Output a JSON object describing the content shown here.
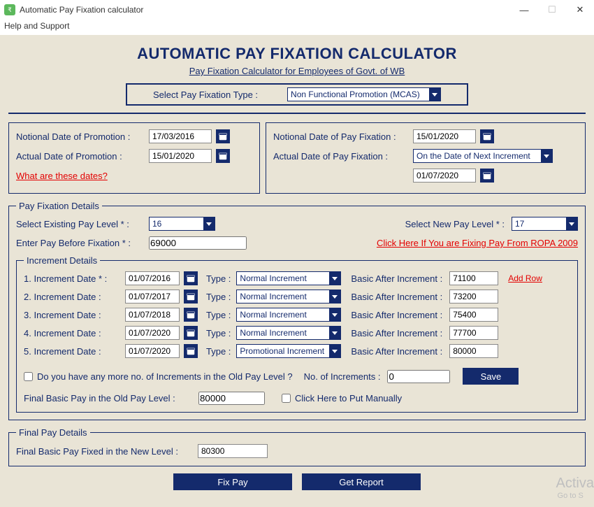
{
  "window": {
    "title": "Automatic Pay Fixation calculator",
    "menu_help": "Help and Support"
  },
  "header": {
    "title": "AUTOMATIC PAY FIXATION CALCULATOR",
    "subtitle": "Pay Fixation Calculator for Employees of Govt. of WB",
    "select_type_label": "Select Pay Fixation Type :",
    "select_type_value": "Non Functional Promotion (MCAS)"
  },
  "left": {
    "notional_label": "Notional Date of Promotion :",
    "notional_date": "17/03/2016",
    "actual_label": "Actual Date of Promotion :",
    "actual_date": "15/01/2020",
    "what_link": "What are these dates?"
  },
  "right": {
    "notional_fix_label": "Notional Date of Pay Fixation :",
    "notional_fix_date": "15/01/2020",
    "actual_fix_label": "Actual Date of Pay Fixation :",
    "actual_fix_value": "On the Date of Next Increment",
    "next_inc_date": "01/07/2020"
  },
  "pf": {
    "legend": "Pay Fixation Details",
    "existing_label": "Select Existing Pay Level * :",
    "existing_value": "16",
    "new_label": "Select New Pay Level * :",
    "new_value": "17",
    "before_label": "Enter Pay Before Fixation * :",
    "before_value": "69000",
    "ropa_link": "Click Here If You are Fixing Pay From ROPA 2009"
  },
  "inc": {
    "legend": "Increment Details",
    "type_label": "Type :",
    "bai_label": "Basic After Increment :",
    "add_row": "Add Row",
    "rows": [
      {
        "idx": "1. Increment Date * :",
        "date": "01/07/2016",
        "type": "Normal Increment",
        "bai": "71100"
      },
      {
        "idx": "2. Increment Date :",
        "date": "01/07/2017",
        "type": "Normal Increment",
        "bai": "73200"
      },
      {
        "idx": "3. Increment Date :",
        "date": "01/07/2018",
        "type": "Normal Increment",
        "bai": "75400"
      },
      {
        "idx": "4. Increment Date :",
        "date": "01/07/2020",
        "type": "Normal Increment",
        "bai": "77700"
      },
      {
        "idx": "5. Increment Date :",
        "date": "01/07/2020",
        "type": "Promotional Increment",
        "bai": "80000"
      }
    ],
    "more_q": "Do you have any more no. of Increments in the Old Pay Level ?",
    "num_label": "No. of Increments :",
    "num_value": "0",
    "save": "Save",
    "final_old_label": "Final Basic Pay in the Old Pay Level :",
    "final_old_value": "80000",
    "manual": "Click Here to Put Manually"
  },
  "final": {
    "legend": "Final Pay Details",
    "label": "Final Basic Pay Fixed in the New Level :",
    "value": "80300"
  },
  "buttons": {
    "fix": "Fix Pay",
    "report": "Get Report"
  },
  "watermark": {
    "big": "Activa",
    "small": "Go to S"
  }
}
